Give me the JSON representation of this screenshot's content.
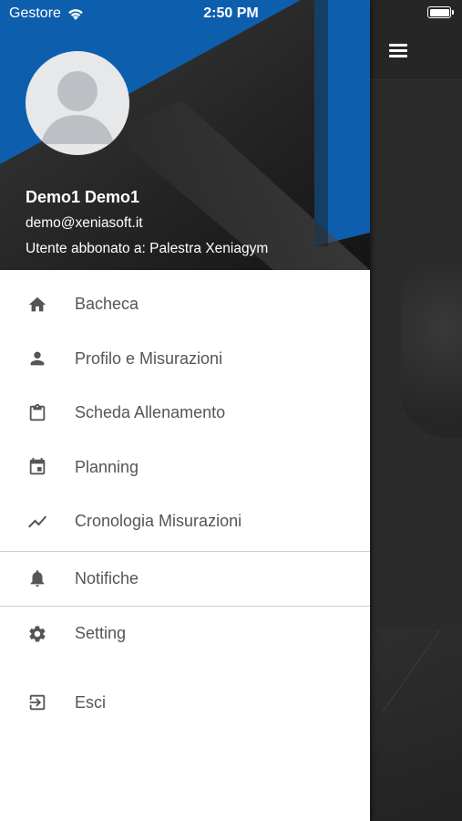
{
  "status_bar": {
    "carrier": "Gestore",
    "time": "2:50 PM"
  },
  "header": {
    "name": "Demo1 Demo1",
    "email": "demo@xeniasoft.it",
    "subscription": "Utente abbonato a: Palestra Xeniagym",
    "colors": {
      "accent": "#1565c0",
      "dark": "#1e1e1e"
    }
  },
  "menu": {
    "items": [
      {
        "label": "Bacheca",
        "icon": "home-icon"
      },
      {
        "label": "Profilo e Misurazioni",
        "icon": "person-icon"
      },
      {
        "label": "Scheda Allenamento",
        "icon": "clipboard-icon"
      },
      {
        "label": "Planning",
        "icon": "calendar-icon"
      },
      {
        "label": "Cronologia Misurazioni",
        "icon": "trending-icon"
      },
      {
        "label": "Notifiche",
        "icon": "bell-icon"
      },
      {
        "label": "Setting",
        "icon": "gear-icon"
      },
      {
        "label": "Esci",
        "icon": "logout-icon"
      }
    ]
  }
}
